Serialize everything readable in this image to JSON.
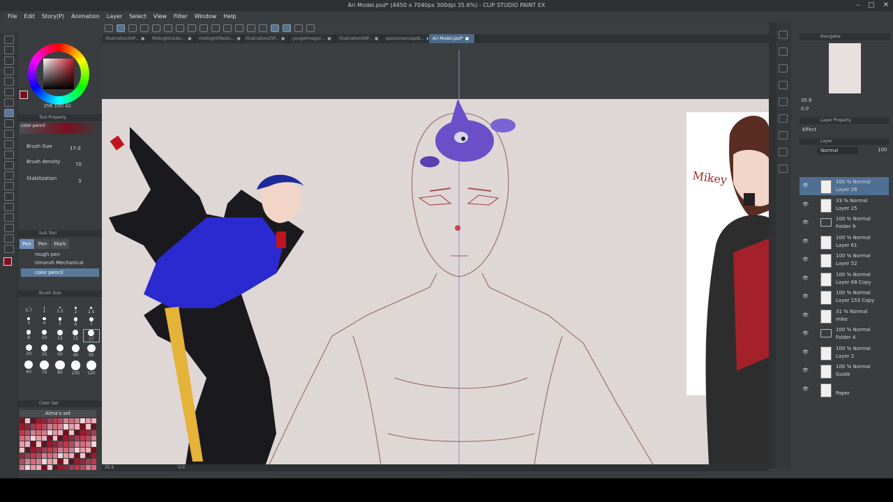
{
  "window": {
    "title": "Ari Model.psd* (4450 x 7040px 300dpi 35.6%) - CLIP STUDIO PAINT EX",
    "controls": [
      "–",
      "□",
      "✕"
    ]
  },
  "menu": [
    "File",
    "Edit",
    "Story(P)",
    "Animation",
    "Layer",
    "Select",
    "View",
    "Filter",
    "Window",
    "Help"
  ],
  "tabs": [
    {
      "label": "illustration30P..."
    },
    {
      "label": "Midnightclubn..."
    },
    {
      "label": "midnight[Resto..."
    },
    {
      "label": "illustration25P..."
    },
    {
      "label": "yougetmegon..."
    },
    {
      "label": "illustration36P..."
    },
    {
      "label": "spooncoonceptd..."
    },
    {
      "label": "Ari Model.psd*",
      "active": true
    }
  ],
  "color": {
    "main": "#7a1020",
    "readout": "356 100 42"
  },
  "tool_property": {
    "header": "Tool Property",
    "preset": "color pencil",
    "rows": [
      {
        "label": "Brush Size",
        "value": "17.0"
      },
      {
        "label": "Brush density",
        "value": "70"
      },
      {
        "label": "Stabilization",
        "value": "3"
      }
    ]
  },
  "sub_tool": {
    "header": "Sub Tool",
    "tabs": [
      "Pen",
      "Pen",
      "Mark"
    ],
    "items": [
      "rough pen",
      "Umaruh Mechanical Pencil",
      "color pencil"
    ],
    "selected": "color pencil"
  },
  "brush_size": {
    "header": "Brush Size",
    "sizes": [
      "0.7",
      "1",
      "1.5",
      "2",
      "2.5",
      "3",
      "4",
      "5",
      "6",
      "7",
      "8",
      "10",
      "12",
      "15",
      "17",
      "20",
      "25",
      "30",
      "40",
      "50",
      "60",
      "70",
      "80",
      "100",
      "120"
    ],
    "selected": "17"
  },
  "color_set": {
    "header": "Color Set",
    "name": "Alma's set"
  },
  "status": {
    "zoom": "35.6",
    "angle": "0.0"
  },
  "navigator": {
    "header": "Navigator",
    "zoom": "35.6",
    "angle": "0.0"
  },
  "layer_property": {
    "header": "Layer Property",
    "effect_label": "Effect"
  },
  "layer_panel": {
    "header": "Layer",
    "blend": "Normal",
    "opacity": "100",
    "layers": [
      {
        "l1": "100 % Normal",
        "l2": "Layer 26",
        "selected": true,
        "type": "raster"
      },
      {
        "l1": "33 % Normal",
        "l2": "Layer 25",
        "type": "raster"
      },
      {
        "l1": "100 % Normal",
        "l2": "Folder 9",
        "type": "folder"
      },
      {
        "l1": "100 % Normal",
        "l2": "Layer 61",
        "type": "raster"
      },
      {
        "l1": "100 % Normal",
        "l2": "Layer 52",
        "type": "raster"
      },
      {
        "l1": "100 % Normal",
        "l2": "Layer 68 Copy",
        "type": "raster"
      },
      {
        "l1": "100 % Normal",
        "l2": "Layer 153 Copy",
        "type": "raster"
      },
      {
        "l1": "31 % Normal",
        "l2": "mike",
        "type": "raster"
      },
      {
        "l1": "100 % Normal",
        "l2": "Folder 4",
        "type": "folder"
      },
      {
        "l1": "100 % Normal",
        "l2": "Layer 2",
        "type": "raster"
      },
      {
        "l1": "100 % Normal",
        "l2": "Guide",
        "type": "raster"
      },
      {
        "l1": "",
        "l2": "Paper",
        "type": "paper"
      }
    ]
  },
  "canvas": {
    "inset_signature": "Mikey"
  }
}
